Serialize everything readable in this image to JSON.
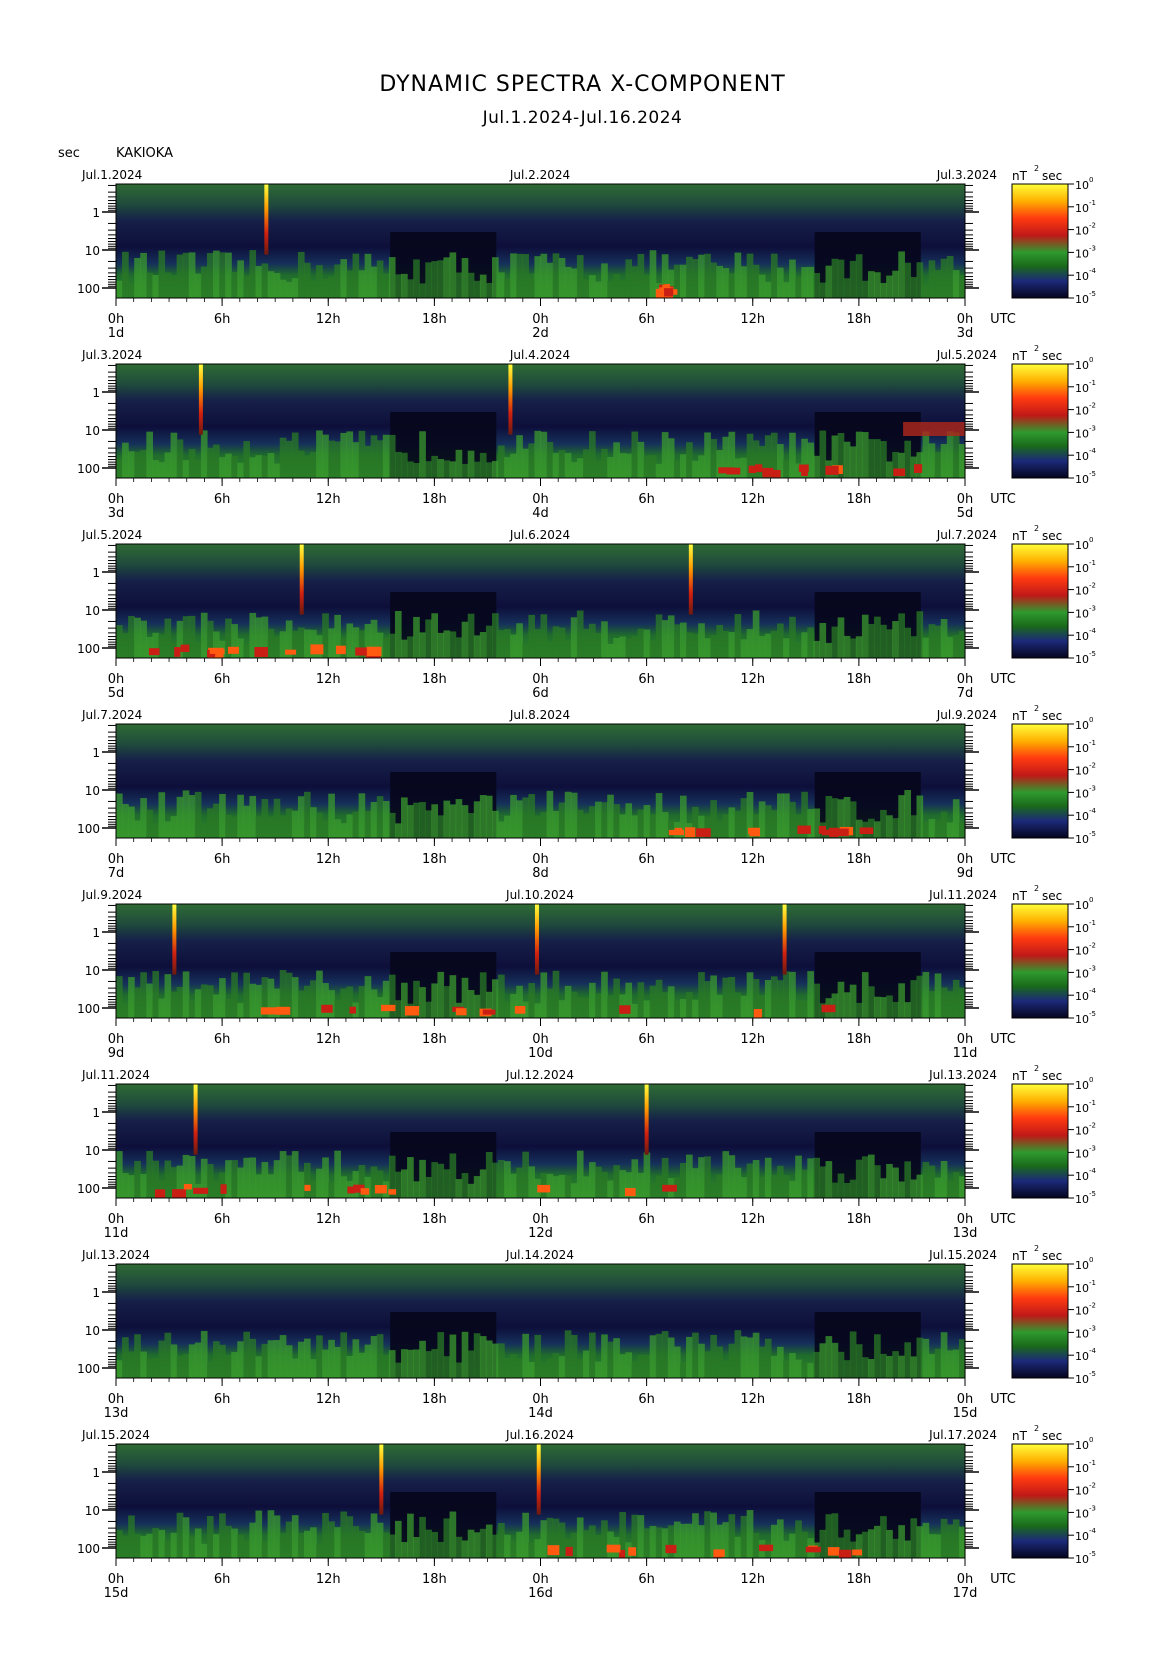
{
  "header": {
    "title": "DYNAMIC SPECTRA X-COMPONENT",
    "subtitle": "Jul.1.2024-Jul.16.2024",
    "unit_sec": "sec",
    "station": "KAKIOKA"
  },
  "chart_data": {
    "type": "heatmap",
    "y_label": "sec",
    "y_scale": "log",
    "y_ticks": [
      "1",
      "10",
      "100"
    ],
    "x_ticks": [
      "0h",
      "6h",
      "12h",
      "18h",
      "0h",
      "6h",
      "12h",
      "18h",
      "0h"
    ],
    "x_unit": "UTC",
    "colorbar_label": "nT",
    "colorbar_exponent": "2",
    "colorbar_unit": "sec",
    "colorbar_ticks": [
      "0",
      "-1",
      "-2",
      "-3",
      "-4",
      "-5"
    ],
    "colorscale": [
      "#0a0a2e",
      "#1a1a6e",
      "#1f7a1f",
      "#3aa13a",
      "#d42020",
      "#ff5010",
      "#ffb000",
      "#ffff30"
    ],
    "panels": [
      {
        "left_date": "Jul.1.2024",
        "mid_date": "Jul.2.2024",
        "right_date": "Jul.3.2024",
        "day_labels": [
          "1d",
          "2d",
          "3d"
        ],
        "spikes": [
          8.5
        ],
        "red_spans": [
          [
            30.5,
            31
          ]
        ],
        "high_bands": []
      },
      {
        "left_date": "Jul.3.2024",
        "mid_date": "Jul.4.2024",
        "right_date": "Jul.5.2024",
        "day_labels": [
          "3d",
          "4d",
          "5d"
        ],
        "spikes": [
          4.8,
          22.3
        ],
        "red_spans": [
          [
            34,
            47
          ]
        ],
        "high_bands": [
          [
            44.5,
            48
          ]
        ]
      },
      {
        "left_date": "Jul.5.2024",
        "mid_date": "Jul.6.2024",
        "right_date": "Jul.7.2024",
        "day_labels": [
          "5d",
          "6d",
          "7d"
        ],
        "spikes": [
          10.5,
          32.5
        ],
        "red_spans": [
          [
            1,
            15
          ]
        ],
        "high_bands": []
      },
      {
        "left_date": "Jul.7.2024",
        "mid_date": "Jul.8.2024",
        "right_date": "Jul.9.2024",
        "day_labels": [
          "7d",
          "8d",
          "9d"
        ],
        "spikes": [],
        "red_spans": [
          [
            31,
            44
          ]
        ],
        "high_bands": []
      },
      {
        "left_date": "Jul.9.2024",
        "mid_date": "Jul.10.2024",
        "right_date": "Jul.11.2024",
        "day_labels": [
          "9d",
          "10d",
          "11d"
        ],
        "spikes": [
          3.3,
          23.8,
          37.8
        ],
        "red_spans": [
          [
            8,
            40
          ]
        ],
        "high_bands": []
      },
      {
        "left_date": "Jul.11.2024",
        "mid_date": "Jul.12.2024",
        "right_date": "Jul.13.2024",
        "day_labels": [
          "11d",
          "12d",
          "13d"
        ],
        "spikes": [
          4.5,
          30
        ],
        "red_spans": [
          [
            1,
            33
          ]
        ],
        "high_bands": []
      },
      {
        "left_date": "Jul.13.2024",
        "mid_date": "Jul.14.2024",
        "right_date": "Jul.15.2024",
        "day_labels": [
          "13d",
          "14d",
          "15d"
        ],
        "spikes": [],
        "red_spans": [],
        "high_bands": []
      },
      {
        "left_date": "Jul.15.2024",
        "mid_date": "Jul.16.2024",
        "right_date": "Jul.17.2024",
        "day_labels": [
          "15d",
          "16d",
          "17d"
        ],
        "spikes": [
          15,
          23.9
        ],
        "red_spans": [
          [
            24,
            42
          ]
        ],
        "high_bands": []
      }
    ]
  }
}
